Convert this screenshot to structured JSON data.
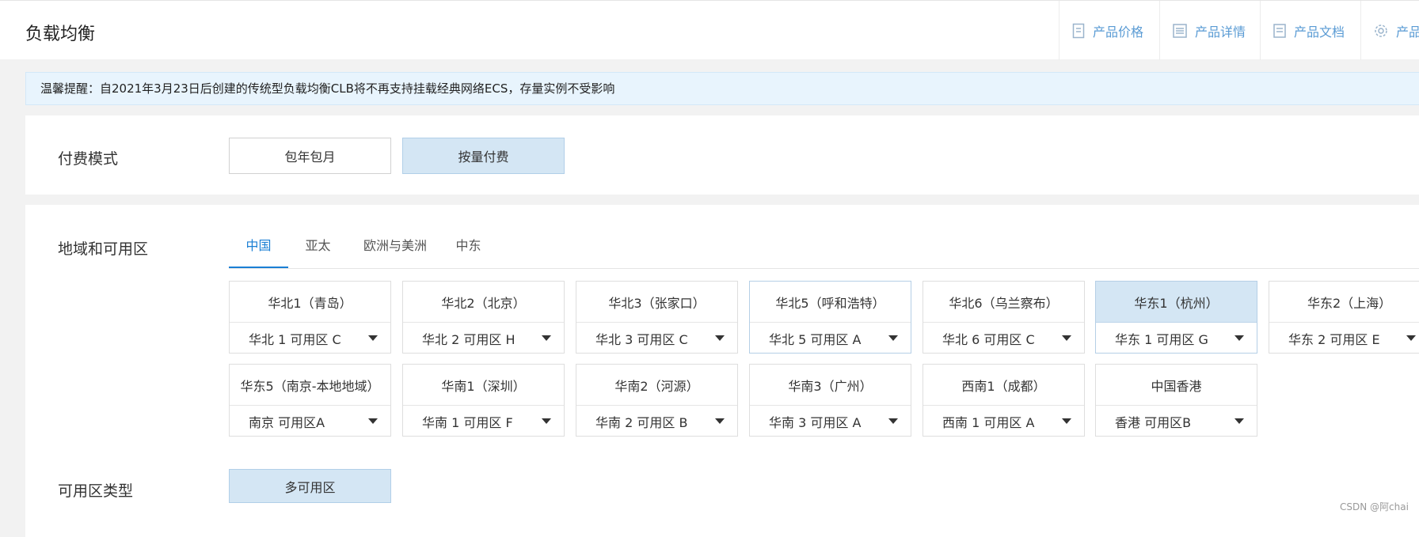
{
  "header": {
    "title": "负载均衡",
    "links": [
      {
        "label": "产品价格",
        "icon": "receipt-icon"
      },
      {
        "label": "产品详情",
        "icon": "list-icon"
      },
      {
        "label": "产品文档",
        "icon": "document-icon"
      },
      {
        "label": "产品",
        "icon": "gear-icon"
      }
    ]
  },
  "notice": "温馨提醒：自2021年3月23日后创建的传统型负载均衡CLB将不再支持挂载经典网络ECS，存量实例不受影响",
  "billing": {
    "label": "付费模式",
    "options": [
      "包年包月",
      "按量付费"
    ],
    "selected": "按量付费"
  },
  "region": {
    "label": "地域和可用区",
    "tabs": [
      "中国",
      "亚太",
      "欧洲与美洲",
      "中东"
    ],
    "active_tab": "中国",
    "zones": [
      {
        "name": "华北1（青岛）",
        "zone": "华北 1 可用区 C"
      },
      {
        "name": "华北2（北京）",
        "zone": "华北 2 可用区 H"
      },
      {
        "name": "华北3（张家口）",
        "zone": "华北 3 可用区 C"
      },
      {
        "name": "华北5（呼和浩特）",
        "zone": "华北 5 可用区 A"
      },
      {
        "name": "华北6（乌兰察布）",
        "zone": "华北 6 可用区 C"
      },
      {
        "name": "华东1（杭州）",
        "zone": "华东 1 可用区 G"
      },
      {
        "name": "华东2（上海）",
        "zone": "华东 2 可用区 E"
      },
      {
        "name": "华东5（南京-本地地域）",
        "zone": "南京 可用区A"
      },
      {
        "name": "华南1（深圳）",
        "zone": "华南 1 可用区 F"
      },
      {
        "name": "华南2（河源）",
        "zone": "华南 2 可用区 B"
      },
      {
        "name": "华南3（广州）",
        "zone": "华南 3 可用区 A"
      },
      {
        "name": "西南1（成都）",
        "zone": "西南 1 可用区 A"
      },
      {
        "name": "中国香港",
        "zone": "香港 可用区B"
      }
    ],
    "selected_zone": "华东1（杭州）"
  },
  "zone_type": {
    "label": "可用区类型",
    "options": [
      "多可用区"
    ],
    "selected": "多可用区"
  },
  "watermark": "CSDN @阿chai",
  "colors": {
    "accent": "#1a7fd4",
    "selected_bg": "#d4e6f4",
    "notice_bg": "#e8f4fd",
    "link": "#5a9bd4"
  }
}
